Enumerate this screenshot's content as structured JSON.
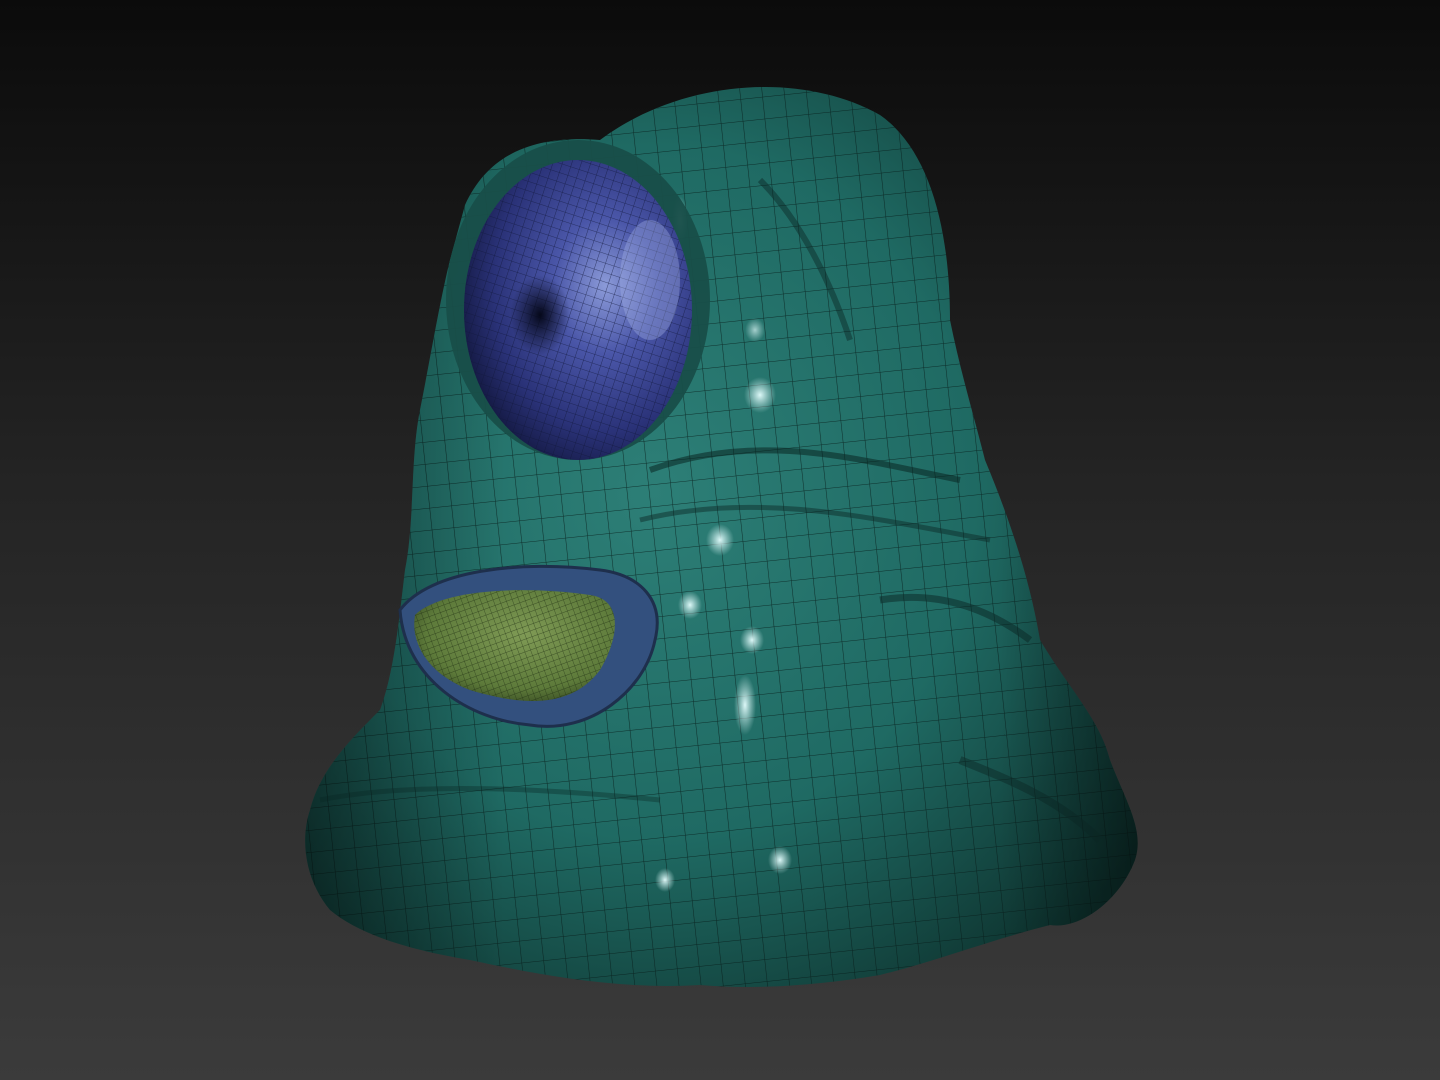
{
  "viewport": {
    "background_top": "#0b0b0b",
    "background_bottom": "#3b3b3b"
  },
  "model": {
    "body_color": "#1f6a63",
    "body_highlight": "#4f9f96",
    "body_shadow": "#0d302c",
    "eye_color": "#2a3278",
    "eye_highlight": "#8b9ad8",
    "lip_color": "#33507e",
    "tongue_color": "#5d7a3a",
    "wire_color": "#061a18",
    "specular_color": "#cfeeee"
  }
}
